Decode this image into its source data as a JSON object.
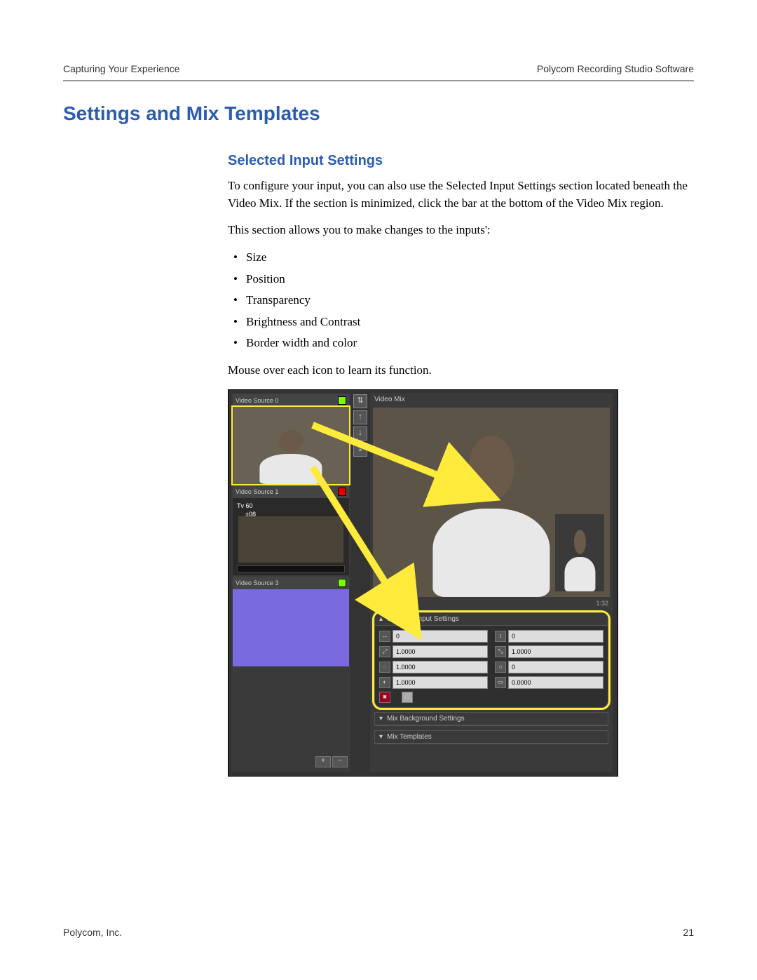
{
  "header": {
    "left": "Capturing Your Experience",
    "right": "Polycom Recording Studio Software"
  },
  "h1": "Settings and Mix Templates",
  "h2": "Selected Input Settings",
  "para1": "To configure your input, you can also use the Selected Input Settings section located beneath the Video Mix. If the section is minimized, click the bar at the bottom of the Video Mix region.",
  "para2": "This section allows you to make changes to the inputs':",
  "bullets": [
    "Size",
    "Position",
    "Transparency",
    "Brightness and Contrast",
    "Border width and color"
  ],
  "para3": "Mouse over each icon to learn its function.",
  "figure": {
    "sources": [
      {
        "label": "Video Source 0",
        "status": "green",
        "selected": true
      },
      {
        "label": "Video Source 1",
        "status": "red",
        "selected": false,
        "overlay_tv": "Tv 60",
        "overlay_iso": "±08"
      },
      {
        "label": "Video Source 3",
        "status": "green",
        "selected": false,
        "blue": true
      }
    ],
    "src_footer": {
      "plus": "+",
      "minus": "−"
    },
    "side_buttons": [
      "⇅",
      "↑",
      "↓",
      "⤓"
    ],
    "mix_title": "Video Mix",
    "timecode": "1:32",
    "selected_panel_title": "Selected Input Settings",
    "fields": {
      "pos_x": {
        "icon": "↔",
        "value": "0"
      },
      "pos_y": {
        "icon": "↕",
        "value": "0"
      },
      "scale_x": {
        "icon": "⤢",
        "value": "1.0000"
      },
      "scale_y": {
        "icon": "⤡",
        "value": "1.0000"
      },
      "alpha": {
        "icon": "◌",
        "value": "1.0000"
      },
      "bright": {
        "icon": "☼",
        "value": "0"
      },
      "contrast": {
        "icon": "◐",
        "value": "1.0000"
      },
      "border": {
        "icon": "▭",
        "value": "0.0000"
      },
      "fgcolor": {
        "icon": "■",
        "value": ""
      },
      "bgcolor": {
        "icon": "□",
        "value": ""
      }
    },
    "collapsed_panels": [
      "Mix Background Settings",
      "Mix Templates"
    ]
  },
  "footer": {
    "company": "Polycom, Inc.",
    "page": "21"
  }
}
